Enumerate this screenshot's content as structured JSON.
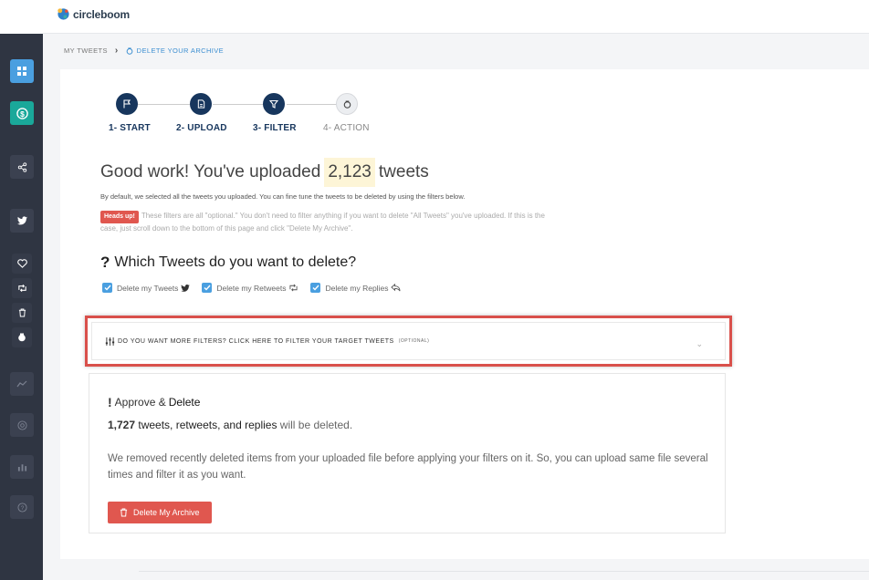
{
  "brand": {
    "name": "circleboom"
  },
  "sidebar": {
    "items": [
      {
        "icon": "dashboard-icon",
        "color": "#4a9fe0"
      },
      {
        "icon": "dollar-icon",
        "color": "#1aa89a"
      },
      {
        "icon": "share-icon"
      },
      {
        "icon": "twitter-icon"
      },
      {
        "icon": "heart-icon"
      },
      {
        "icon": "retweet-icon"
      },
      {
        "icon": "trash-icon"
      },
      {
        "icon": "archive-icon"
      },
      {
        "icon": "analytics-icon"
      },
      {
        "icon": "target-icon"
      },
      {
        "icon": "chart-icon"
      },
      {
        "icon": "help-icon"
      }
    ]
  },
  "breadcrumb": {
    "parent": "MY TWEETS",
    "current": "DELETE YOUR ARCHIVE"
  },
  "steps": [
    {
      "label": "1- START",
      "icon": "flag-icon",
      "active": true
    },
    {
      "label": "2- UPLOAD",
      "icon": "file-icon",
      "active": true
    },
    {
      "label": "3- FILTER",
      "icon": "filter-icon",
      "active": true
    },
    {
      "label": "4- ACTION",
      "icon": "action-icon",
      "active": false
    }
  ],
  "headline": {
    "prefix": "Good work! You've uploaded",
    "count": "2,123",
    "suffix": "tweets"
  },
  "subtext": "By default, we selected all the tweets you uploaded. You can fine tune the tweets to be deleted by using the filters below.",
  "headsup": {
    "badge": "Heads up!",
    "text": "These filters are all \"optional.\" You don't need to filter anything if you want to delete \"All Tweets\" you've uploaded. If this is the case, just scroll down to the bottom of this page and click \"Delete My Archive\"."
  },
  "question": {
    "mark": "?",
    "text": "Which Tweets do you want to delete?"
  },
  "checkboxes": [
    {
      "label": "Delete my Tweets",
      "checked": true,
      "icon": "twitter-icon"
    },
    {
      "label": "Delete my Retweets",
      "checked": true,
      "icon": "retweet-icon"
    },
    {
      "label": "Delete my Replies",
      "checked": true,
      "icon": "reply-icon"
    }
  ],
  "filters": {
    "title": "DO YOU WANT MORE FILTERS? CLICK HERE TO FILTER YOUR TARGET TWEETS",
    "optional": "(OPTIONAL)"
  },
  "approve": {
    "mark": "!",
    "title_a": "Approve &",
    "title_b": "Delete",
    "count": "1,727",
    "types": "tweets, retweets, and replies",
    "rest": "will be deleted.",
    "description": "We removed recently deleted items from your uploaded file before applying your filters on it. So, you can upload same file several times and filter it as you want.",
    "button": "Delete My Archive"
  },
  "colors": {
    "accent": "#4a9fe0",
    "danger": "#e0574f",
    "navy": "#17365d",
    "sidebar": "#2f3542"
  }
}
